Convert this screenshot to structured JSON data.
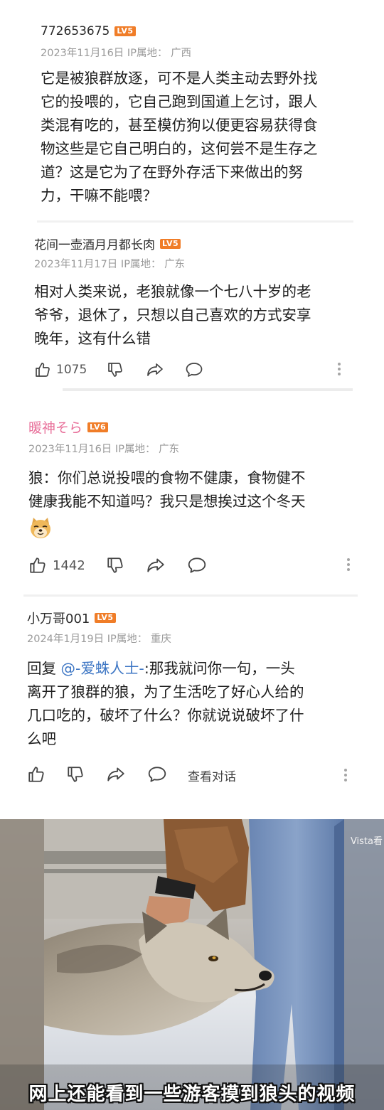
{
  "comments": [
    {
      "username": "772653675",
      "level": "LV5",
      "date": "2023年11月16日",
      "ip_label": "IP属地：",
      "ip": "广西",
      "lines": [
        "它是被狼群放逐，可不是人类主动去野外找",
        "它的投喂的，它自己跑到国道上乞讨，跟人",
        "类混有吃的，甚至模仿狗以便更容易获得食",
        "物这些是它自己明白的，这何尝不是生存之",
        "道？这是它为了在野外存活下来做出的努",
        "力，干嘛不能喂？"
      ]
    },
    {
      "username": "花间一壶酒月月都长肉",
      "level": "LV5",
      "date": "2023年11月17日",
      "ip_label": "IP属地：",
      "ip": "广东",
      "lines": [
        "相对人类来说，老狼就像一个七八十岁的老",
        "爷爷，退休了，只想以自己喜欢的方式安享",
        "晚年，这有什么错"
      ],
      "likes": "1075"
    },
    {
      "username": "暖神そら",
      "level": "LV6",
      "date": "2023年11月16日",
      "ip_label": "IP属地：",
      "ip": "广东",
      "lines": [
        "狼：你们总说投喂的食物不健康，食物健不",
        "健康我能不知道吗？我只是想挨过这个冬天"
      ],
      "emoji": "doge-emoji",
      "likes": "1442"
    },
    {
      "username": "小万哥001",
      "level": "LV5",
      "date": "2024年1月19日",
      "ip_label": "IP属地：",
      "ip": "重庆",
      "reply_prefix": "回复 ",
      "reply_to": "@-爱蛛人士-",
      "lines": [
        ":那我就问你一句，一头",
        "离开了狼群的狼，为了生活吃了好心人给的",
        "几口吃的，破坏了什么？你就说说破坏了什",
        "么吧"
      ],
      "view_conversation": "查看对话"
    }
  ],
  "icons": [
    "thumb-up-icon",
    "thumb-down-icon",
    "share-icon",
    "comment-icon",
    "more-icon"
  ],
  "video": {
    "watermark": "Vista看",
    "caption": "网上还能看到一些游客摸到狼头的视频"
  },
  "colors": {
    "level_badge": "#f07d28",
    "pink_username": "#e8709a",
    "reply_link": "#3d76c4",
    "meta_text": "#9a9a9a"
  }
}
